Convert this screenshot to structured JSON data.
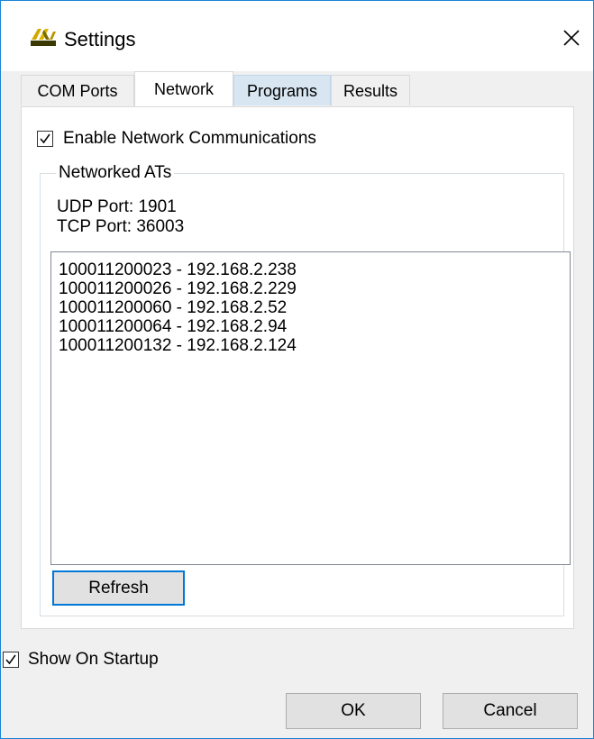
{
  "window": {
    "title": "Settings",
    "accent": "#1883d7"
  },
  "icons": {
    "app": "app-logo-icon",
    "close": "close-icon",
    "check": "checkmark-icon"
  },
  "tabs": [
    {
      "label": "COM Ports",
      "active": false
    },
    {
      "label": "Network",
      "active": true
    },
    {
      "label": "Programs",
      "active": false,
      "hover": true
    },
    {
      "label": "Results",
      "active": false
    }
  ],
  "network": {
    "enable_label": "Enable Network Communications",
    "enable_checked": true,
    "group_title": "Networked ATs",
    "udp_port": "UDP Port: 1901",
    "tcp_port": "TCP Port: 36003",
    "devices": [
      "100011200023 - 192.168.2.238",
      "100011200026 - 192.168.2.229",
      "100011200060 - 192.168.2.52",
      "100011200064 - 192.168.2.94",
      "100011200132 - 192.168.2.124"
    ],
    "refresh_label": "Refresh"
  },
  "footer": {
    "show_startup_label": "Show On Startup",
    "show_startup_checked": true,
    "ok_label": "OK",
    "cancel_label": "Cancel"
  }
}
